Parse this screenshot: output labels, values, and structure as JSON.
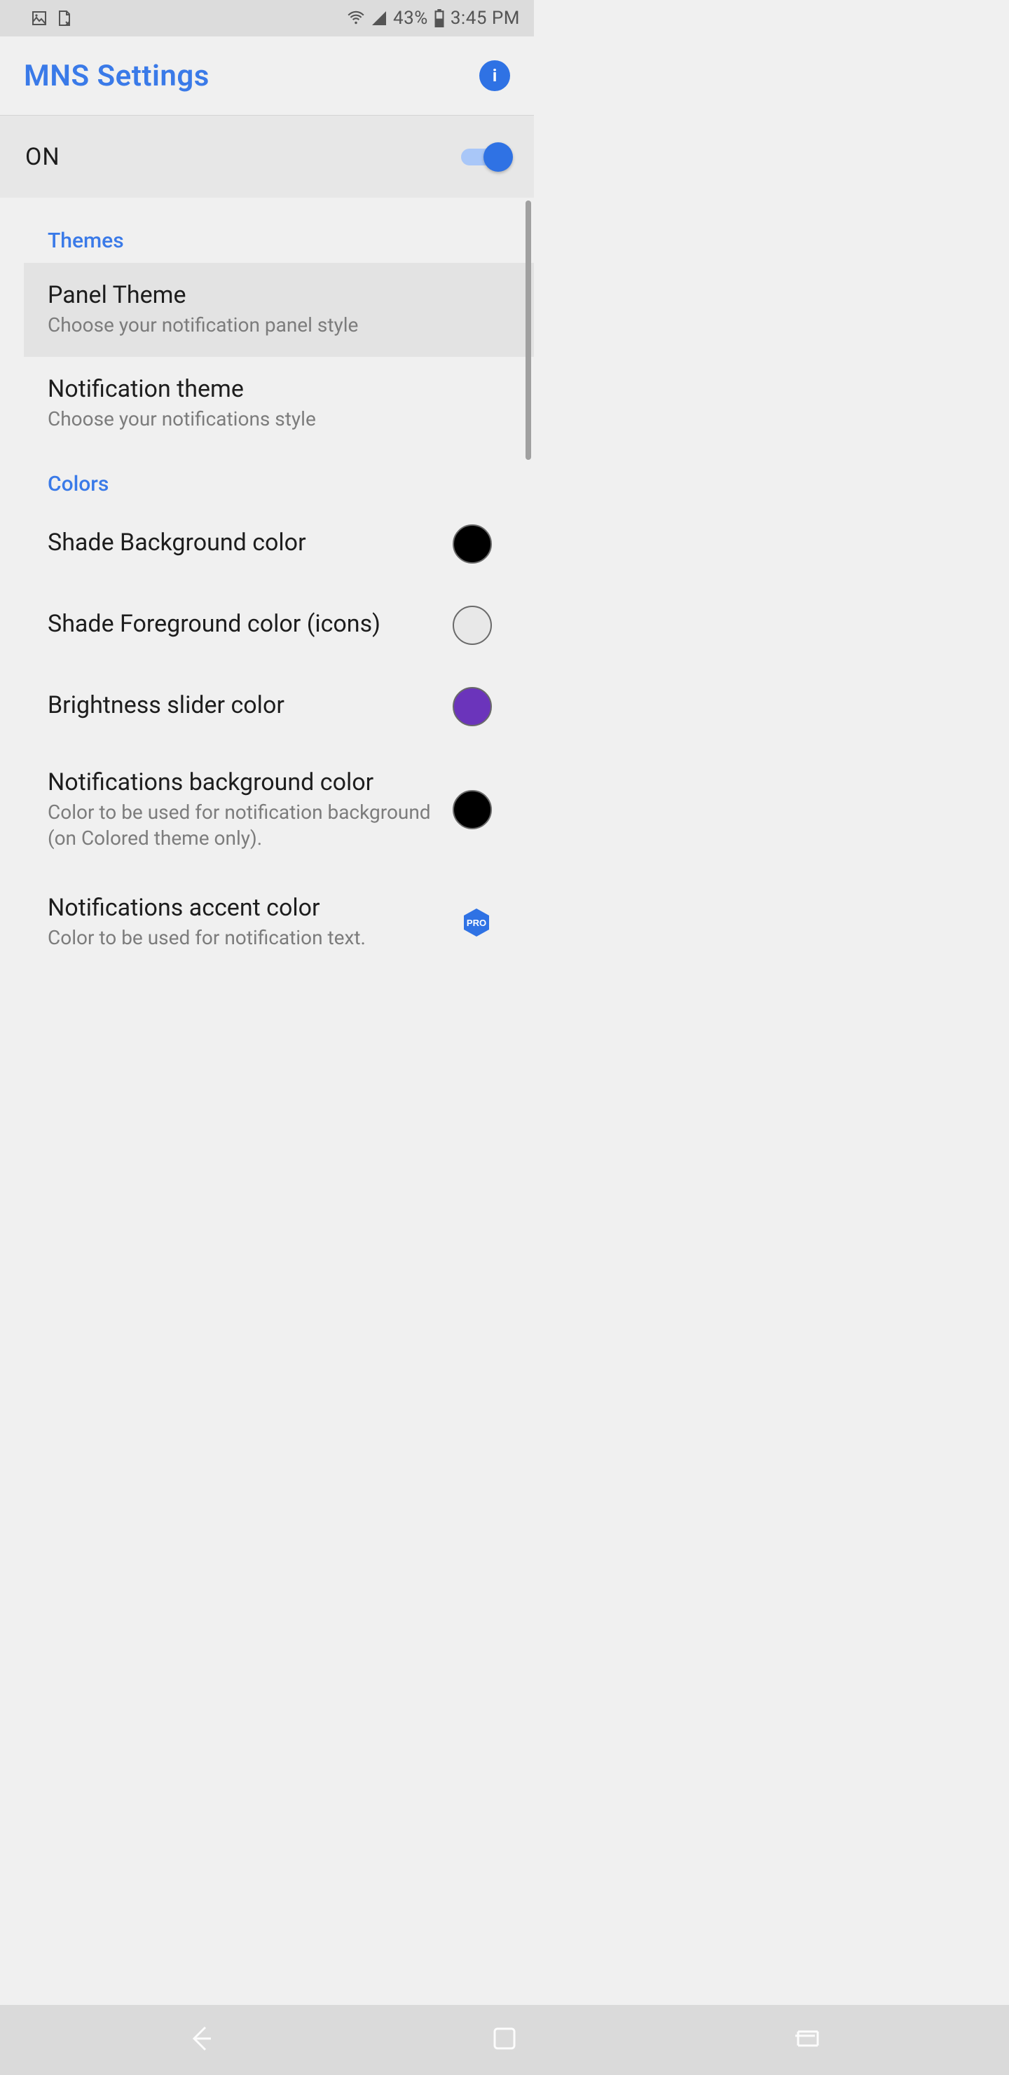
{
  "status": {
    "battery_pct": "43%",
    "time": "3:45 PM"
  },
  "appbar": {
    "title": "MNS Settings",
    "info_glyph": "i"
  },
  "master": {
    "label": "ON",
    "state": true
  },
  "sections": {
    "themes": {
      "header": "Themes",
      "panel": {
        "title": "Panel Theme",
        "summary": "Choose your notification panel style"
      },
      "notif": {
        "title": "Notification theme",
        "summary": "Choose your notifications style"
      }
    },
    "colors": {
      "header": "Colors",
      "shade_bg": {
        "title": "Shade Background color",
        "color": "#000000"
      },
      "shade_fg": {
        "title": "Shade Foreground color (icons)",
        "color": "#e8e8e8"
      },
      "brightness": {
        "title": "Brightness slider color",
        "color": "#6b34bb"
      },
      "notif_bg": {
        "title": "Notifications background color",
        "summary": "Color to be used for notification background (on Colored theme only).",
        "color": "#000000"
      },
      "notif_accent": {
        "title": "Notifications accent color",
        "summary": "Color to be used for notification text.",
        "pro_label": "PRO"
      }
    }
  }
}
